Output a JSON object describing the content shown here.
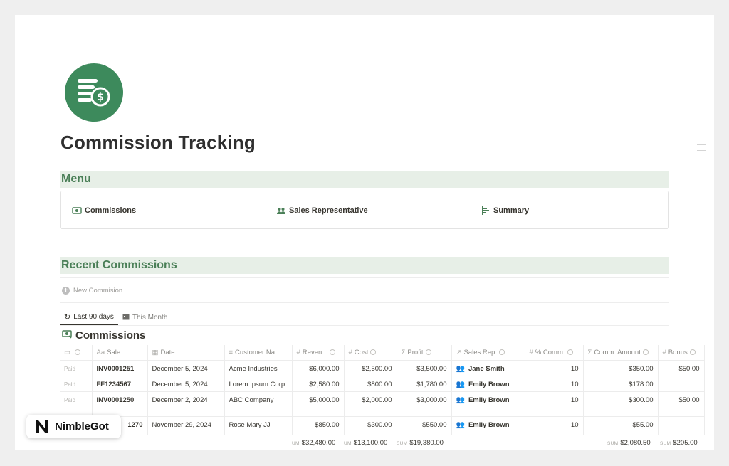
{
  "page": {
    "title": "Commission Tracking"
  },
  "menu": {
    "heading": "Menu",
    "items": [
      {
        "label": "Commissions",
        "icon": "money-icon"
      },
      {
        "label": "Sales Representative",
        "icon": "people-icon"
      },
      {
        "label": "Summary",
        "icon": "chart-icon"
      }
    ]
  },
  "recent": {
    "heading": "Recent Commissions",
    "new_button": "New Commision",
    "views": [
      {
        "label": "Last 90 days",
        "icon": "refresh-icon",
        "active": true
      },
      {
        "label": "This Month",
        "icon": "calendar-icon",
        "active": false
      }
    ],
    "db_title": "Commissions"
  },
  "table": {
    "columns": [
      "",
      "Sale",
      "Date",
      "Customer Na...",
      "Reven...",
      "Cost",
      "Profit",
      "Sales Rep.",
      "% Comm.",
      "Comm. Amount",
      "Bonus"
    ],
    "rows": [
      {
        "status": "Paid",
        "sale": "INV0001251",
        "date": "December 5, 2024",
        "customer": "Acme Industries",
        "revenue": "$6,000.00",
        "cost": "$2,500.00",
        "profit": "$3,500.00",
        "rep": "Jane Smith",
        "pct": "10",
        "amount": "$350.00",
        "bonus": "$50.00"
      },
      {
        "status": "Paid",
        "sale": "FF1234567",
        "date": "December 5, 2024",
        "customer": "Lorem Ipsum Corp.",
        "revenue": "$2,580.00",
        "cost": "$800.00",
        "profit": "$1,780.00",
        "rep": "Emily Brown",
        "pct": "10",
        "amount": "$178.00",
        "bonus": ""
      },
      {
        "status": "Paid",
        "sale": "INV0001250",
        "date": "December 2, 2024",
        "customer": "ABC Company",
        "revenue": "$5,000.00",
        "cost": "$2,000.00",
        "profit": "$3,000.00",
        "rep": "Emily Brown",
        "pct": "10",
        "amount": "$300.00",
        "bonus": "$50.00"
      },
      {
        "status": "",
        "sale": "1270",
        "date": "November 29, 2024",
        "customer": "Rose Mary JJ",
        "revenue": "$850.00",
        "cost": "$300.00",
        "profit": "$550.00",
        "rep": "Emily Brown",
        "pct": "10",
        "amount": "$55.00",
        "bonus": ""
      }
    ],
    "sums": {
      "revenue_label": "UM",
      "revenue": "$32,480.00",
      "cost_label": "UM",
      "cost": "$13,100.00",
      "profit_label": "SUM",
      "profit": "$19,380.00",
      "amount_label": "SUM",
      "amount": "$2,080.50",
      "bonus_label": "SUM",
      "bonus": "$205.00"
    }
  },
  "badge": {
    "text": "NimbleGot"
  },
  "colors": {
    "accent": "#3d8a5c",
    "section_bg": "#e7efe7",
    "section_text": "#4a7f57"
  }
}
